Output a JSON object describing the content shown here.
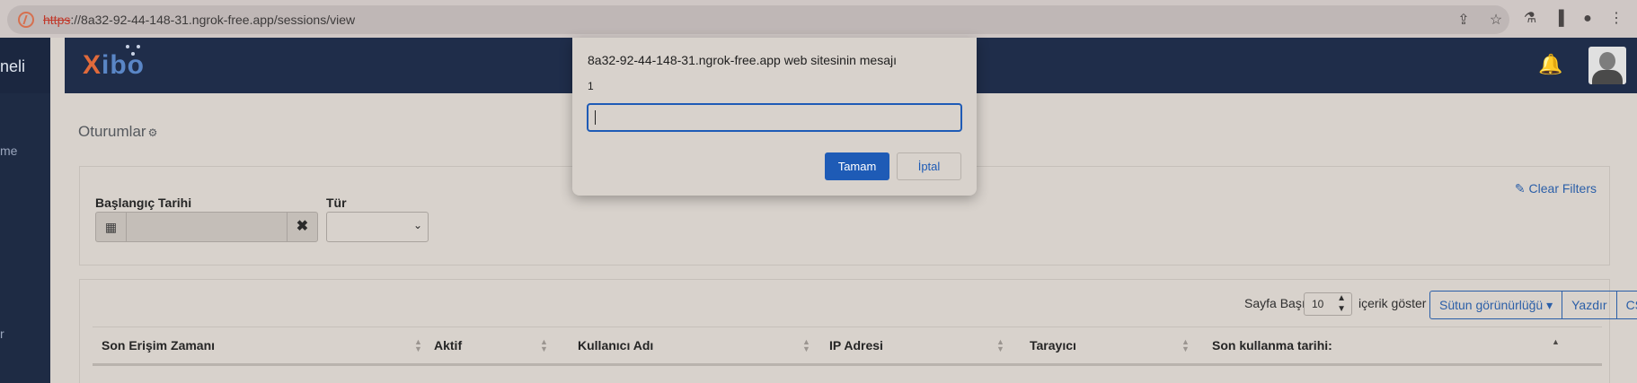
{
  "browser": {
    "url_scheme": "https",
    "url_rest": "://8a32-92-44-148-31.ngrok-free.app/sessions/view"
  },
  "sidebar": {
    "title_fragment": "neli",
    "item_fragment_1": "me",
    "item_fragment_2": "r"
  },
  "app": {
    "logo_x": "X",
    "logo_rest": "ibo",
    "page_title": "Oturumlar"
  },
  "filters": {
    "clear_filters": "Clear Filters",
    "start_date_label": "Başlangıç Tarihi",
    "type_label": "Tür",
    "start_date_value": "",
    "type_value": ""
  },
  "table": {
    "per_page_label": "Sayfa Başı",
    "per_page_value": "10",
    "show_entries_label": "içerik göster",
    "buttons": [
      "Sütun görünürlüğü",
      "Yazdır",
      "CSV"
    ],
    "columns": [
      "Son Erişim Zamanı",
      "Aktif",
      "Kullanıcı Adı",
      "IP Adresi",
      "Tarayıcı",
      "Son kullanma tarihi:"
    ]
  },
  "dialog": {
    "title": "8a32-92-44-148-31.ngrok-free.app web sitesinin mesajı",
    "message": "1",
    "input_value": "",
    "ok_label": "Tamam",
    "cancel_label": "İptal"
  },
  "colors": {
    "navbar": "#1f2d4a",
    "accent_blue": "#1e5bb6",
    "logo_orange": "#e06a3b"
  }
}
